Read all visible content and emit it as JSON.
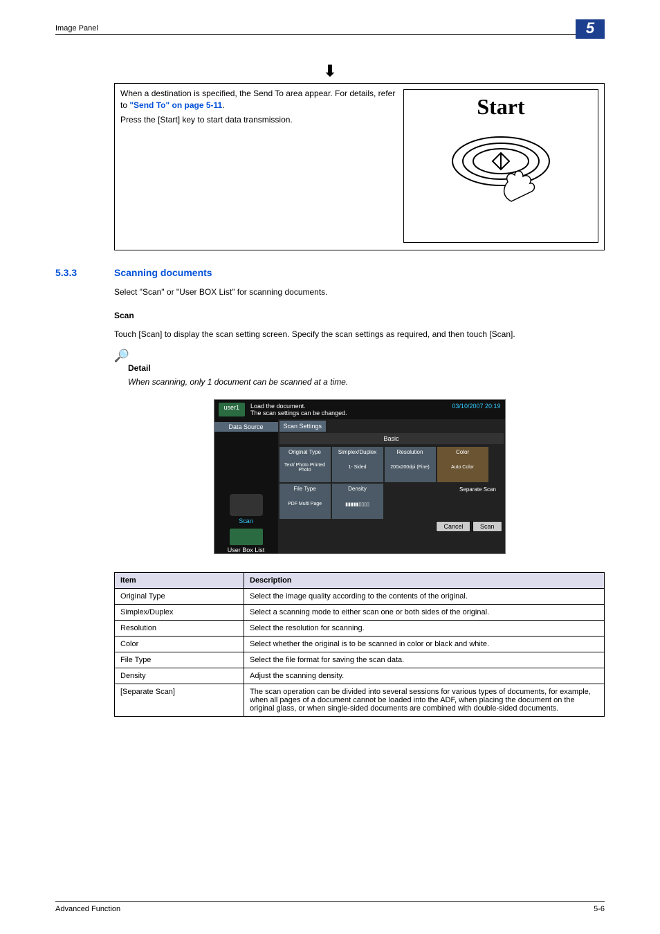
{
  "header": {
    "section": "Image Panel",
    "chapter": "5"
  },
  "flow_box": {
    "line1_a": "When a destination is specified, the Send To area appear. For details, refer to ",
    "line1_link": "\"Send To\" on page 5-11",
    "line1_b": ".",
    "line2": "Press the [Start] key to start data transmission.",
    "start_label": "Start"
  },
  "heading": {
    "num": "5.3.3",
    "title": "Scanning documents"
  },
  "intro": "Select \"Scan\" or \"User BOX List\" for scanning documents.",
  "scan_head": "Scan",
  "scan_body": "Touch [Scan] to display the scan setting screen. Specify the scan settings as required, and then touch [Scan].",
  "detail_label": "Detail",
  "detail_body": "When scanning, only 1 document can be scanned at a time.",
  "shot": {
    "user": "user1",
    "msg1": "Load the document.",
    "msg2": "The scan settings can be changed.",
    "datetime": "03/10/2007  20:19",
    "data_source": "Data Source",
    "scan_btn": "Scan",
    "userbox_btn": "User Box List",
    "tab_settings": "Scan Settings",
    "basic": "Basic",
    "h_orig": "Original Type",
    "h_simp": "Simplex/Duplex",
    "h_res": "Resolution",
    "h_col": "Color",
    "h_ft": "File Type",
    "h_den": "Density",
    "v_orig": "Text/\nPhoto\nPrinted\nPhoto",
    "v_simp": "1-\nSided",
    "v_res": "200x200dpi\n(Fine)",
    "v_col": "Auto Color",
    "v_ft": "PDF\nMulti Page",
    "sep": "Separate Scan",
    "cancel": "Cancel",
    "scan": "Scan"
  },
  "table": {
    "h_item": "Item",
    "h_desc": "Description",
    "rows": [
      {
        "item": "Original Type",
        "desc": "Select the image quality according to the contents of the original."
      },
      {
        "item": "Simplex/Duplex",
        "desc": "Select a scanning mode to either scan one or both sides of the original."
      },
      {
        "item": "Resolution",
        "desc": "Select the resolution for scanning."
      },
      {
        "item": "Color",
        "desc": "Select whether the original is to be scanned in color or black and white."
      },
      {
        "item": "File Type",
        "desc": "Select the file format for saving the scan data."
      },
      {
        "item": "Density",
        "desc": "Adjust the scanning density."
      },
      {
        "item": "[Separate Scan]",
        "desc": "The scan operation can be divided into several sessions for various types of documents, for example, when all pages of a document cannot be loaded into the ADF, when placing the document on the original glass, or when single-sided documents are combined with double-sided documents."
      }
    ]
  },
  "footer": {
    "left": "Advanced Function",
    "right": "5-6"
  }
}
